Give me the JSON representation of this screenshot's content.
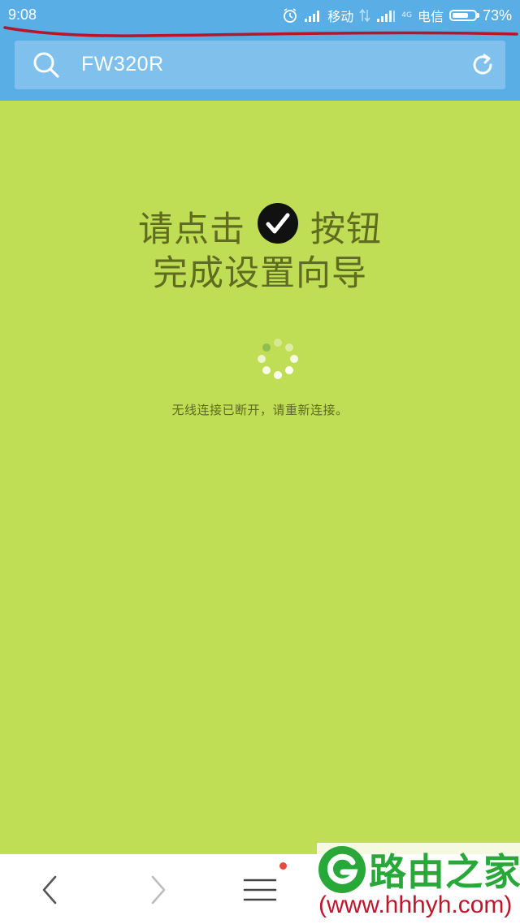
{
  "status_bar": {
    "time": "9:08",
    "carrier1": "移动",
    "carrier2": "电信",
    "network_tag": "4G",
    "battery_percent": "73%",
    "battery_level": 0.73,
    "icons": [
      "alarm-icon",
      "signal-icon",
      "data-arrows-icon",
      "signal-icon",
      "battery-icon"
    ]
  },
  "address_bar": {
    "url": "FW320R",
    "icons": [
      "search-icon",
      "refresh-icon"
    ]
  },
  "page": {
    "instruction_prefix": "请点击",
    "instruction_suffix": "按钮",
    "instruction_line2": "完成设置向导",
    "notice": "无线连接已断开，请重新连接。",
    "icons": [
      "check-circle-icon",
      "loading-spinner-icon"
    ]
  },
  "bottom_nav": {
    "icons": [
      "chevron-left-icon",
      "chevron-right-icon",
      "menu-icon"
    ]
  },
  "watermark": {
    "name": "路由之家",
    "url": "(www.hhhyh.com)"
  },
  "colors": {
    "header_blue": "#5aaee6",
    "page_green": "#bfdd55",
    "text_olive": "#5f6b1f",
    "watermark_green": "#29a83a",
    "watermark_red": "#c0162b",
    "notification_dot": "#e84a3c"
  }
}
